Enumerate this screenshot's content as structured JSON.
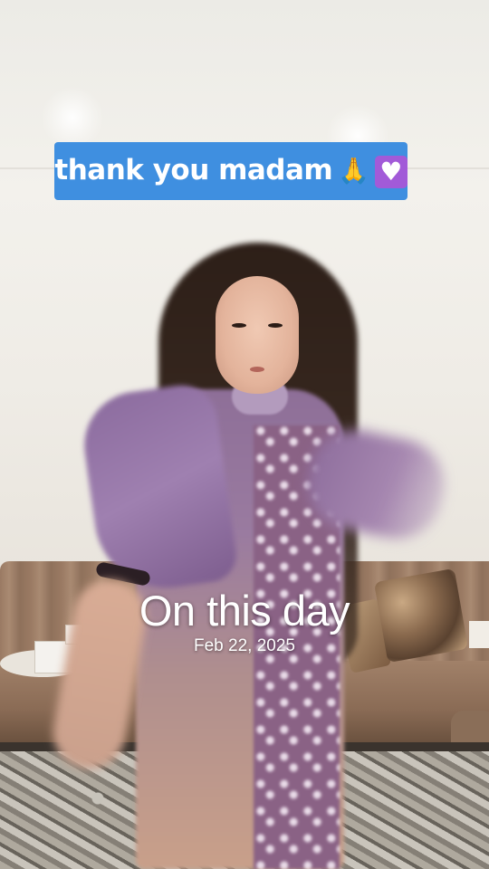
{
  "caption": {
    "text": "thank you madam",
    "emoji_1": "🙏",
    "emoji_2": "heart-emoji",
    "background_color": "#3f8fe0"
  },
  "memory": {
    "title": "On this day",
    "date": "Feb 22, 2025"
  }
}
